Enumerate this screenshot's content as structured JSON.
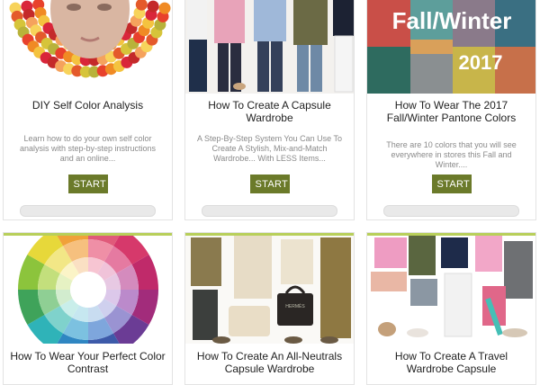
{
  "cards": [
    {
      "title": "DIY Self Color Analysis",
      "desc": "Learn how to do your own self color analysis with step-by-step instructions and an online...",
      "button": "START"
    },
    {
      "title": "How To Create A Capsule Wardrobe",
      "desc": "A Step-By-Step System You Can Use To Create A Stylish, Mix-and-Match Wardrobe... With LESS Items...",
      "button": "START"
    },
    {
      "title": "How To Wear The 2017 Fall/Winter Pantone Colors",
      "desc": "There are 10 colors that you will see everywhere in stores this Fall and Winter....",
      "button": "START"
    },
    {
      "title": "How To Wear Your Perfect Color Contrast"
    },
    {
      "title": "How To Create An All-Neutrals Capsule Wardrobe"
    },
    {
      "title": "How To Create A Travel Wardrobe Capsule"
    }
  ],
  "fallwinter": {
    "line1": "Fall/Winter",
    "line2": "2017"
  },
  "bag_label": "HERMÈS",
  "colors": {
    "accent": "#6b7a2a",
    "green_bar": "#b8cf5a"
  },
  "progress": [
    0,
    0,
    0
  ]
}
